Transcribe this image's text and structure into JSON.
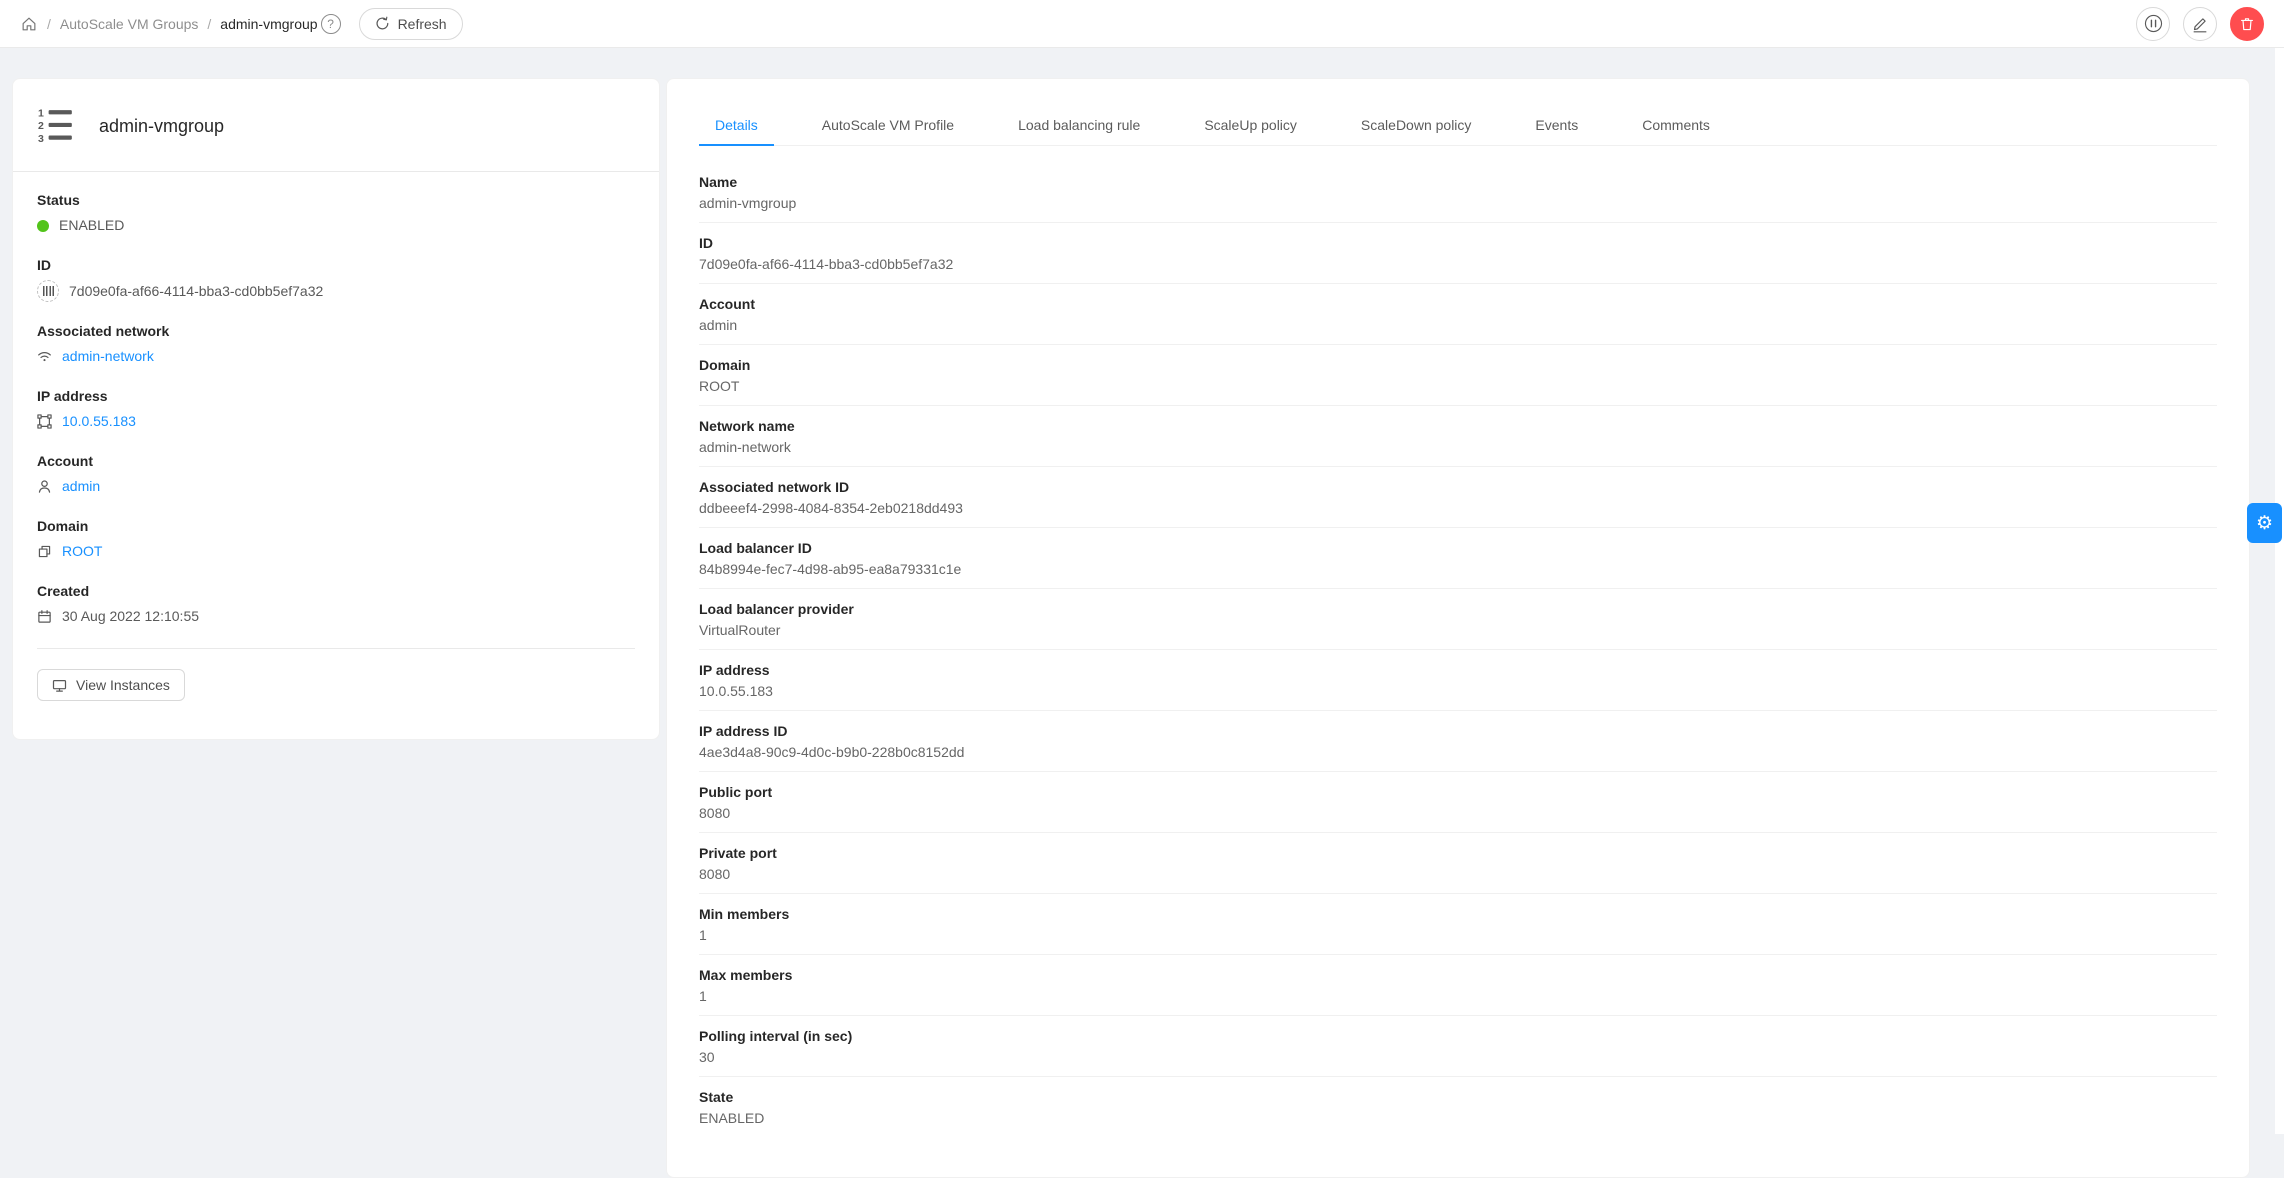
{
  "header": {
    "breadcrumb": {
      "home_icon": "home-icon",
      "items": [
        "AutoScale VM Groups",
        "admin-vmgroup"
      ],
      "help_icon_label": "?"
    },
    "refresh_label": "Refresh",
    "actions": [
      {
        "name": "pause",
        "icon": "pause-circle-icon",
        "danger": false
      },
      {
        "name": "edit",
        "icon": "edit-icon",
        "danger": false
      },
      {
        "name": "delete",
        "icon": "trash-icon",
        "danger": true
      }
    ]
  },
  "info_card": {
    "icon": "ordered-list-icon",
    "title": "admin-vmgroup",
    "sections": [
      {
        "label": "Status",
        "value": "ENABLED",
        "icon": "status-dot",
        "link": false
      },
      {
        "label": "ID",
        "value": "7d09e0fa-af66-4114-bba3-cd0bb5ef7a32",
        "icon": "barcode-icon",
        "link": false
      },
      {
        "label": "Associated network",
        "value": "admin-network",
        "icon": "wifi-icon",
        "link": true
      },
      {
        "label": "IP address",
        "value": "10.0.55.183",
        "icon": "gateway-icon",
        "link": true
      },
      {
        "label": "Account",
        "value": "admin",
        "icon": "user-icon",
        "link": true
      },
      {
        "label": "Domain",
        "value": "ROOT",
        "icon": "block-icon",
        "link": true
      },
      {
        "label": "Created",
        "value": "30 Aug 2022 12:10:55",
        "icon": "calendar-icon",
        "link": false
      }
    ],
    "view_instances_label": "View Instances",
    "view_instances_icon": "monitor-icon"
  },
  "tabs": {
    "active": "Details",
    "items": [
      "Details",
      "AutoScale VM Profile",
      "Load balancing rule",
      "ScaleUp policy",
      "ScaleDown policy",
      "Events",
      "Comments"
    ]
  },
  "details": [
    {
      "label": "Name",
      "value": "admin-vmgroup"
    },
    {
      "label": "ID",
      "value": "7d09e0fa-af66-4114-bba3-cd0bb5ef7a32"
    },
    {
      "label": "Account",
      "value": "admin"
    },
    {
      "label": "Domain",
      "value": "ROOT"
    },
    {
      "label": "Network name",
      "value": "admin-network"
    },
    {
      "label": "Associated network ID",
      "value": "ddbeeef4-2998-4084-8354-2eb0218dd493"
    },
    {
      "label": "Load balancer ID",
      "value": "84b8994e-fec7-4d98-ab95-ea8a79331c1e"
    },
    {
      "label": "Load balancer provider",
      "value": "VirtualRouter"
    },
    {
      "label": "IP address",
      "value": "10.0.55.183"
    },
    {
      "label": "IP address ID",
      "value": "4ae3d4a8-90c9-4d0c-b9b0-228b0c8152dd"
    },
    {
      "label": "Public port",
      "value": "8080"
    },
    {
      "label": "Private port",
      "value": "8080"
    },
    {
      "label": "Min members",
      "value": "1"
    },
    {
      "label": "Max members",
      "value": "1"
    },
    {
      "label": "Polling interval (in sec)",
      "value": "30"
    },
    {
      "label": "State",
      "value": "ENABLED"
    }
  ],
  "side": {
    "settings_icon": "gear-icon",
    "settings_glyph": "⚙"
  },
  "colors": {
    "primary": "#1890ff",
    "status_enabled": "#52c41a",
    "danger": "#ff4d4f",
    "background": "#f0f2f5"
  }
}
